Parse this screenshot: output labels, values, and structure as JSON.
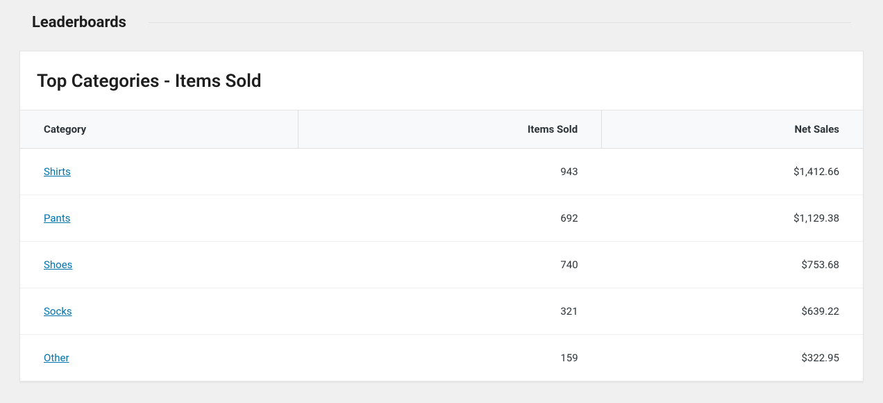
{
  "section_title": "Leaderboards",
  "card_title": "Top Categories - Items Sold",
  "columns": {
    "category": "Category",
    "items_sold": "Items Sold",
    "net_sales": "Net Sales"
  },
  "rows": [
    {
      "category": "Shirts",
      "items_sold": "943",
      "net_sales": "$1,412.66"
    },
    {
      "category": "Pants",
      "items_sold": "692",
      "net_sales": "$1,129.38"
    },
    {
      "category": "Shoes",
      "items_sold": "740",
      "net_sales": "$753.68"
    },
    {
      "category": "Socks",
      "items_sold": "321",
      "net_sales": "$639.22"
    },
    {
      "category": "Other",
      "items_sold": "159",
      "net_sales": "$322.95"
    }
  ]
}
